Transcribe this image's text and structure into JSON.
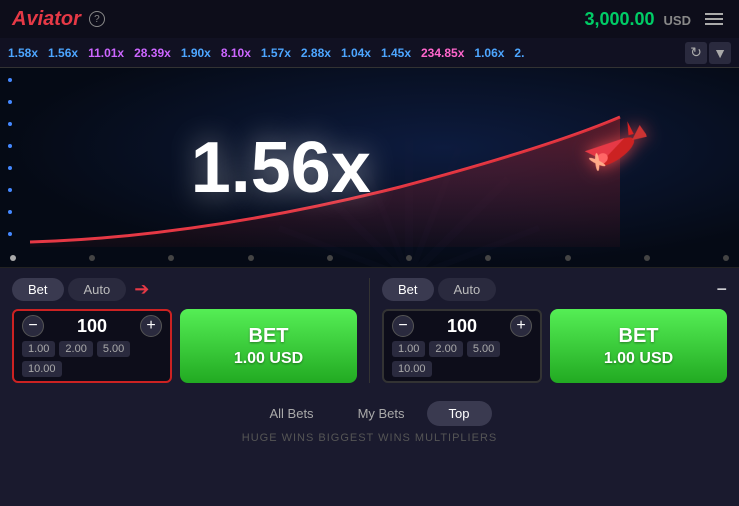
{
  "header": {
    "logo": "Aviator",
    "help_icon": "?",
    "balance": "3,000.00",
    "currency": "USD",
    "menu_label": "menu"
  },
  "ticker": {
    "items": [
      {
        "value": "1.58x",
        "color": "t-blue"
      },
      {
        "value": "1.56x",
        "color": "t-blue"
      },
      {
        "value": "11.01x",
        "color": "t-purple"
      },
      {
        "value": "28.39x",
        "color": "t-purple"
      },
      {
        "value": "1.90x",
        "color": "t-blue"
      },
      {
        "value": "8.10x",
        "color": "t-purple"
      },
      {
        "value": "1.57x",
        "color": "t-blue"
      },
      {
        "value": "2.88x",
        "color": "t-blue"
      },
      {
        "value": "1.04x",
        "color": "t-blue"
      },
      {
        "value": "1.45x",
        "color": "t-blue"
      },
      {
        "value": "234.85x",
        "color": "t-pink"
      },
      {
        "value": "1.06x",
        "color": "t-blue"
      },
      {
        "value": "2.",
        "color": "t-blue"
      }
    ]
  },
  "game": {
    "multiplier": "1.56x",
    "plane_emoji": "✈"
  },
  "bet_panel_left": {
    "tab_bet": "Bet",
    "tab_auto": "Auto",
    "amount": "100",
    "quick1": "1.00",
    "quick2": "2.00",
    "quick3": "5.00",
    "quick4": "10.00",
    "bet_label": "BET",
    "bet_amount": "1.00 USD"
  },
  "bet_panel_right": {
    "tab_bet": "Bet",
    "tab_auto": "Auto",
    "amount": "100",
    "quick1": "1.00",
    "quick2": "2.00",
    "quick3": "5.00",
    "quick4": "10.00",
    "bet_label": "BET",
    "bet_amount": "1.00 USD"
  },
  "bottom": {
    "tab_all": "All Bets",
    "tab_my": "My Bets",
    "tab_top": "Top",
    "marquee": "HUGE WINS  BIGGEST WINS  MULTIPLIERS"
  }
}
